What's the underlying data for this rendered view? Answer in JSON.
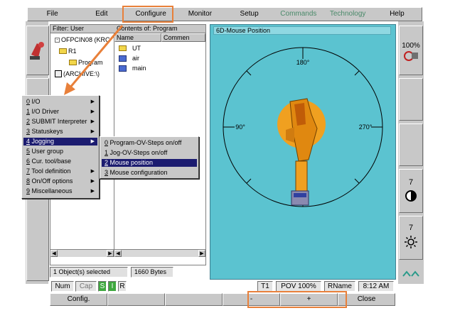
{
  "menu": [
    "File",
    "Edit",
    "Configure",
    "Monitor",
    "Setup",
    "Commands",
    "Technology",
    "Help"
  ],
  "explorer": {
    "filter": "Filter: User",
    "contents": "Contents of: Program",
    "tree": [
      "OFPCIN08 (KRC",
      "R1",
      "Program",
      "(ARCHIVE:\\)"
    ],
    "columns": [
      "Name",
      "Commen"
    ],
    "files": [
      "UT",
      "air",
      "main"
    ],
    "objects_selected": "1 Object(s) selected",
    "bytes": "1660 Bytes"
  },
  "mouse_window": {
    "title": "6D-Mouse Position",
    "angles": {
      "top": "180°",
      "left": "90°",
      "right": "270°"
    }
  },
  "configure_menu": [
    {
      "num": "0",
      "text": " I/O",
      "sub": true
    },
    {
      "num": "1",
      "text": " I/O Driver",
      "sub": true
    },
    {
      "num": "2",
      "text": " SUBMIT Interpreter",
      "sub": true
    },
    {
      "num": "3",
      "text": " Statuskeys",
      "sub": true
    },
    {
      "num": "4",
      "text": " Jogging",
      "sub": true,
      "selected": true
    },
    {
      "num": "5",
      "text": " User group",
      "sub": false
    },
    {
      "num": "6",
      "text": " Cur. tool/base",
      "sub": false
    },
    {
      "num": "7",
      "text": " Tool definition",
      "sub": true
    },
    {
      "num": "8",
      "text": " On/Off options",
      "sub": true
    },
    {
      "num": "9",
      "text": " Miscellaneous",
      "sub": true
    }
  ],
  "jogging_menu": [
    {
      "num": "0",
      "text": " Program-OV-Steps on/off"
    },
    {
      "num": "1",
      "text": " Jog-OV-Steps on/off"
    },
    {
      "num": "2",
      "text": " Mouse position",
      "selected": true
    },
    {
      "num": "3",
      "text": " Mouse configuration"
    }
  ],
  "status": [
    "Num",
    "Cap",
    "S",
    "I",
    "R",
    "T1",
    "POV 100%",
    "RName",
    "8:12 AM"
  ],
  "softkeys": [
    "Config.",
    "",
    "",
    "-",
    "+",
    "Close"
  ],
  "right_panel": {
    "override": "100%",
    "num_a": "7",
    "num_b": "7"
  },
  "colors": {
    "accent_highlight": "#e8803a",
    "mouse_bg": "#5bc3d0",
    "selection": "#1c1c70",
    "robot": "#f0a020"
  }
}
